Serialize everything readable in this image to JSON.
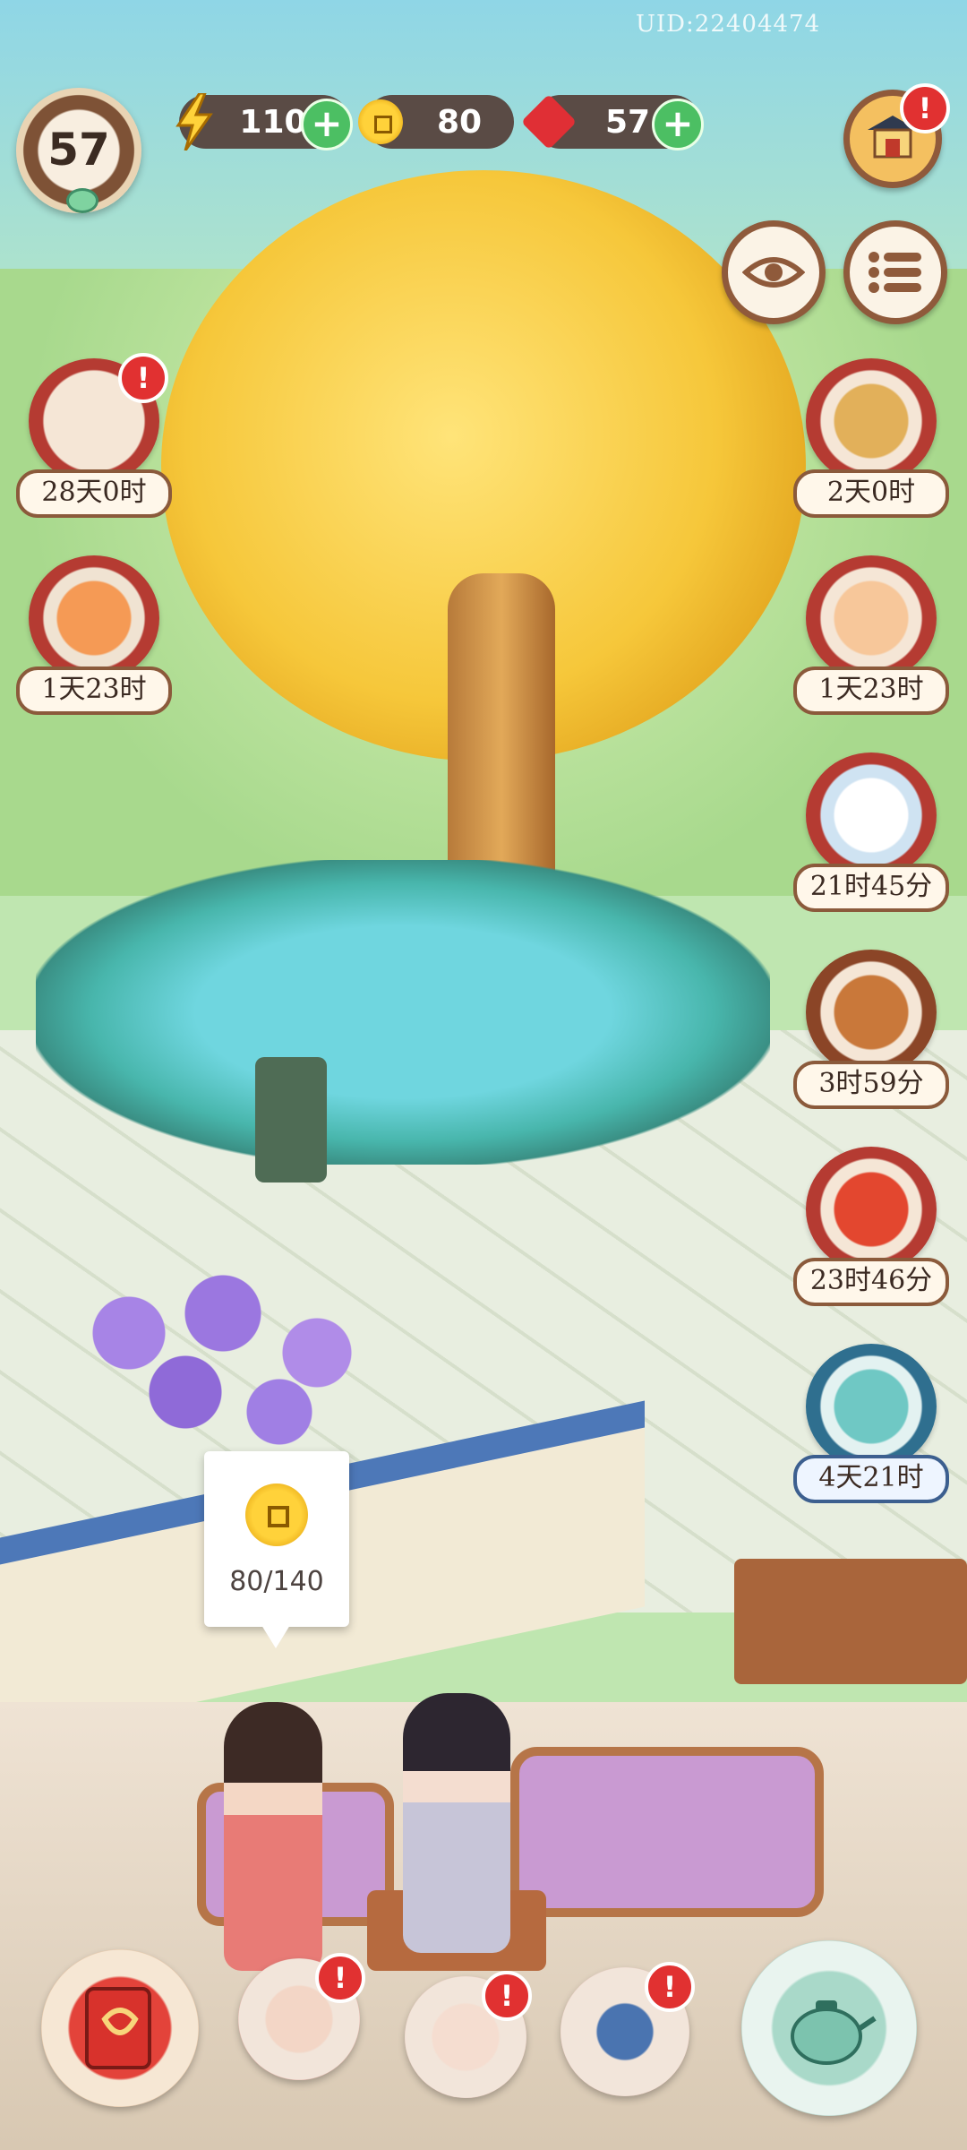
{
  "hud": {
    "uid": "UID:22404474",
    "level": "57",
    "energy": "110",
    "coins": "80",
    "gems": "57",
    "plus": "+"
  },
  "events": [
    {
      "timer": "28天0时",
      "alert": "!"
    },
    {
      "timer": "1天23时"
    },
    {
      "timer": "2天0时"
    },
    {
      "timer": "1天23时"
    },
    {
      "timer": "21时45分"
    },
    {
      "timer": "3时59分"
    },
    {
      "timer": "23时46分"
    },
    {
      "timer": "4天21时"
    }
  ],
  "tooltip": {
    "coin_progress": "80/140"
  },
  "bottom_bar": {
    "alert": "!"
  },
  "icons": {
    "energy": "lightning-icon",
    "coin": "coin-icon",
    "gem": "gem-icon",
    "eye": "eye-icon",
    "menu": "list-icon",
    "shop": "pavilion-shop-icon"
  },
  "colors": {
    "accent_green": "#4cbf63",
    "alert_red": "#e13131",
    "resource_bar": "#5a4b45"
  }
}
